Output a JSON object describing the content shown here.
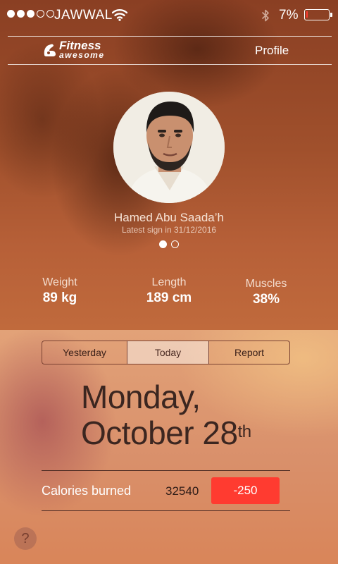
{
  "status_bar": {
    "signal_bars_filled": 3,
    "signal_bars_total": 5,
    "carrier": "JAWWAL",
    "battery_text": "7%",
    "battery_level": 0.07,
    "icons": [
      "wifi-icon",
      "bluetooth-icon",
      "battery-icon"
    ]
  },
  "nav": {
    "logo_line1": "Fitness",
    "logo_line2": "awesome",
    "profile_label": "Profile"
  },
  "user": {
    "name": "Hamed Abu Saada’h",
    "latest_sign_in": "Latest sign in 31/12/2016",
    "page_count": 2,
    "active_page": 1
  },
  "stats": [
    {
      "label": "Weight",
      "value": "89 kg"
    },
    {
      "label": "Length",
      "value": "189 cm"
    },
    {
      "label": "Muscles",
      "value": "38%"
    }
  ],
  "tabs": [
    {
      "label": "Yesterday",
      "active": false
    },
    {
      "label": "Today",
      "active": true
    },
    {
      "label": "Report",
      "active": false
    }
  ],
  "date": {
    "line1": "Monday,",
    "line2": "October 28",
    "suffix": "th"
  },
  "calories": {
    "label": "Calories burned",
    "value": "32540",
    "delta": "-250"
  },
  "help": {
    "label": "?"
  },
  "colors": {
    "accent_red": "#ff3b30",
    "dark_text": "#3b2620"
  }
}
